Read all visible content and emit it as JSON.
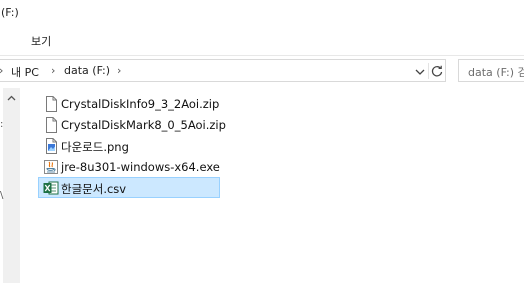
{
  "window": {
    "title": "(F:)"
  },
  "ribbon": {
    "tabs": [
      "보기"
    ]
  },
  "address": {
    "crumbs": [
      "내 PC",
      "data (F:)"
    ],
    "separator": "›",
    "search_placeholder": "data (F:) 검색"
  },
  "files": [
    {
      "name": "CrystalDiskInfo9_3_2Aoi.zip",
      "type": "zip-file-icon",
      "selected": false
    },
    {
      "name": "CrystalDiskMark8_0_5Aoi.zip",
      "type": "zip-file-icon",
      "selected": false
    },
    {
      "name": "다운로드.png",
      "type": "png-file-icon",
      "selected": false
    },
    {
      "name": "jre-8u301-windows-x64.exe",
      "type": "java-exe-icon",
      "selected": false
    },
    {
      "name": "한글문서.csv",
      "type": "excel-csv-icon",
      "selected": true
    }
  ],
  "colors": {
    "selection_bg": "#cce8ff",
    "selection_border": "#99d1ff",
    "excel_green": "#1e7145"
  }
}
